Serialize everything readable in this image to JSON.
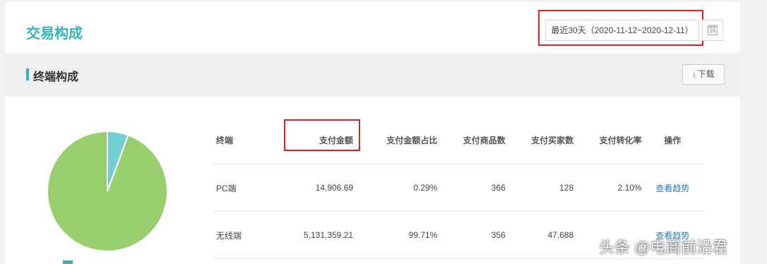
{
  "header": {
    "title": "交易构成",
    "date_range": "最近30天（2020-11-12~2020-12-11）",
    "calendar_number": "16"
  },
  "section": {
    "title": "终端构成",
    "download_label": "下载"
  },
  "table": {
    "columns": [
      "终端",
      "支付金额",
      "支付金额占比",
      "支付商品数",
      "支付买家数",
      "支付转化率",
      "操作"
    ],
    "rows": [
      {
        "terminal": "PC端",
        "amount": "14,906.69",
        "share": "0.29%",
        "items": "366",
        "buyers": "128",
        "conversion": "2.10%",
        "action": "查看趋势"
      },
      {
        "terminal": "无线端",
        "amount": "5,131,359.21",
        "share": "99.71%",
        "items": "356",
        "buyers": "47,688",
        "conversion": "",
        "action": "查看趋势"
      }
    ]
  },
  "chart_data": {
    "type": "pie",
    "categories": [
      "PC端",
      "无线端"
    ],
    "values": [
      0.29,
      99.71
    ],
    "colors": [
      "#72cfd1",
      "#99cf6e"
    ]
  },
  "watermark": "头条 @电商前沿君"
}
